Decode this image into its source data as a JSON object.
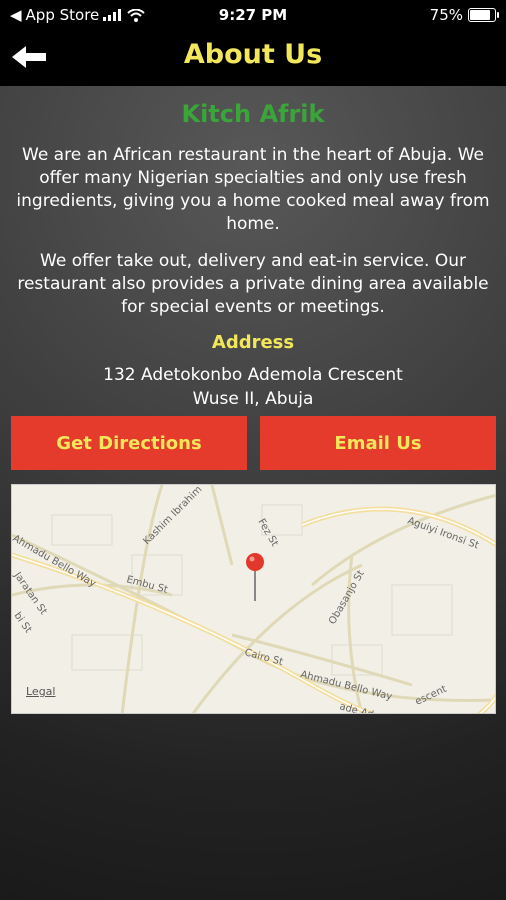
{
  "status_bar": {
    "carrier": "App Store",
    "time": "9:27 PM",
    "battery": "75%"
  },
  "nav": {
    "title": "About Us"
  },
  "brand": "Kitch Afrik",
  "paragraph1": "We are an African restaurant in the heart of Abuja. We offer many Nigerian specialties and only use fresh ingredients, giving you a home cooked meal away from home.",
  "paragraph2": "We offer take out, delivery and eat-in service. Our restaurant also provides a private dining area available for special events or meetings.",
  "address": {
    "heading": "Address",
    "line1": "132 Adetokonbo Ademola Crescent",
    "line2": "Wuse II, Abuja"
  },
  "buttons": {
    "directions": "Get Directions",
    "email": "Email Us"
  },
  "map": {
    "legal": "Legal",
    "streets": {
      "kashim": "Kashim Ibrahim",
      "fez": "Fez St",
      "aguiyi": "Aguiyi Ironsi St",
      "ahmadu1": "Ahmadu Bello Way",
      "embu": "Embu St",
      "jaratan": "Jaratan St",
      "bi": "bi St",
      "obasanjo": "Obasanjo St",
      "cairo": "Cairo St",
      "ahmadu2": "Ahmadu Bello Way",
      "crescent": "escent",
      "ade": "ade Ad"
    }
  },
  "colors": {
    "title_yellow": "#f2e65a",
    "brand_green": "#3aa63a",
    "button_red": "#e53b2c"
  }
}
